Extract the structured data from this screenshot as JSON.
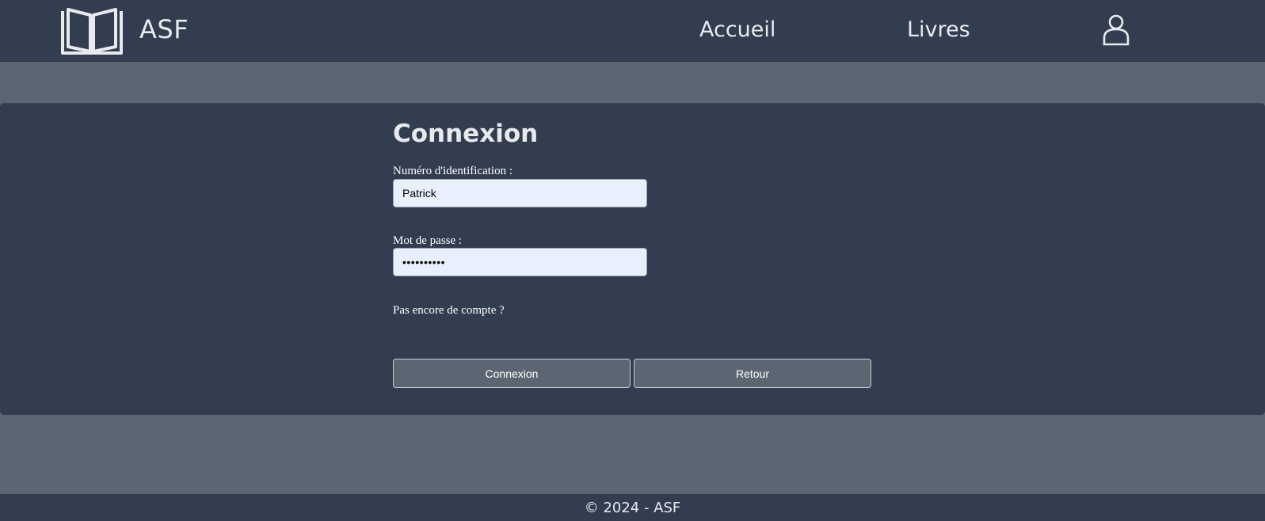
{
  "header": {
    "logo_icon": "open-book-icon",
    "brand": "ASF",
    "nav": {
      "home_label": "Accueil",
      "books_label": "Livres"
    },
    "user_icon": "user-icon"
  },
  "login": {
    "title": "Connexion",
    "id_label": "Numéro d'identification :",
    "id_value": "Patrick",
    "password_label": "Mot de passe :",
    "password_value": "••••••••••",
    "signup_link": "Pas encore de compte ?",
    "submit_label": "Connexion",
    "back_label": "Retour"
  },
  "footer": {
    "text": "© 2024 - ASF"
  },
  "colors": {
    "header_bg": "#323d50",
    "page_bg": "#5c6672",
    "input_bg": "#e8f0fe",
    "text": "#e8eaed"
  }
}
